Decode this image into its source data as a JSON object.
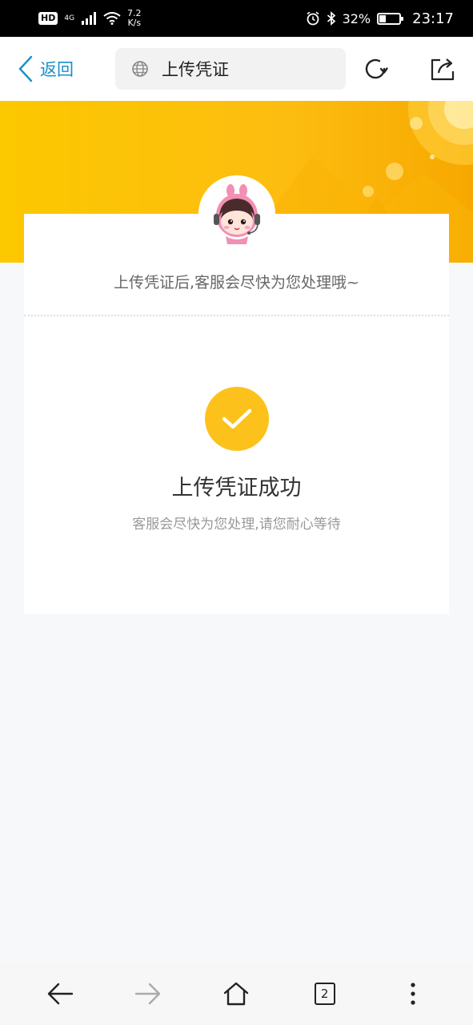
{
  "status_bar": {
    "hd": "HD",
    "network": "4G",
    "speed_value": "7.2",
    "speed_unit": "K/s",
    "battery_percent": "32%",
    "battery_level": 0.32,
    "time": "23:17"
  },
  "top_bar": {
    "back_label": "返回",
    "page_title": "上传凭证"
  },
  "card": {
    "hint": "上传凭证后,客服会尽快为您处理哦~",
    "success_title": "上传凭证成功",
    "success_subtitle": "客服会尽快为您处理,请您耐心等待"
  },
  "bottom_bar": {
    "tab_count": "2"
  },
  "colors": {
    "accent_blue": "#1a8fc8",
    "banner_yellow": "#fcc800",
    "success_yellow": "#fcc21b"
  },
  "icons": {
    "back": "chevron-left-icon",
    "globe": "globe-icon",
    "refresh": "refresh-icon",
    "share": "share-icon",
    "nav_back": "arrow-left-icon",
    "nav_forward": "arrow-right-icon",
    "home": "home-icon",
    "tabs": "tabs-icon",
    "more": "more-vertical-icon",
    "check": "check-icon",
    "avatar": "customer-service-avatar"
  }
}
